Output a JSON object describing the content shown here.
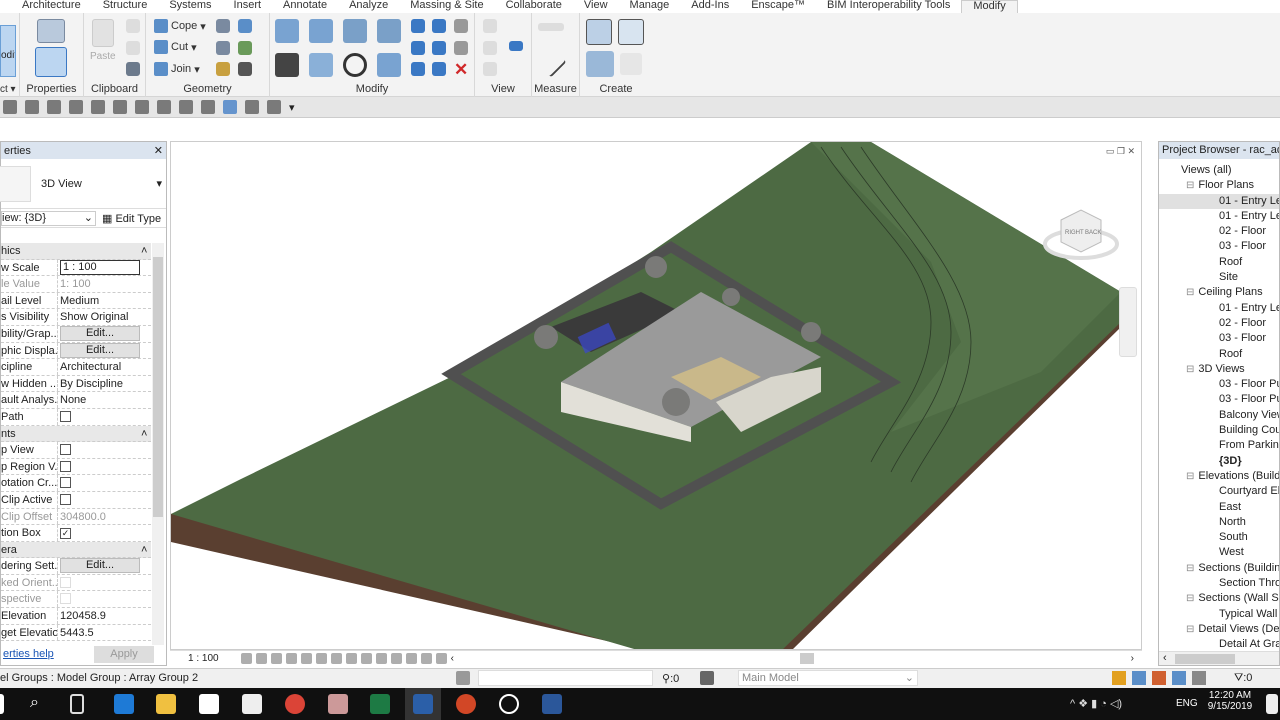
{
  "ribbon": {
    "tabs": [
      "Architecture",
      "Structure",
      "Systems",
      "Insert",
      "Annotate",
      "Analyze",
      "Massing & Site",
      "Collaborate",
      "View",
      "Manage",
      "Add-Ins",
      "Enscape™",
      "BIM Interoperability Tools",
      "Modify"
    ],
    "active_tab": "Modify",
    "modify_label": "odify",
    "select_label": "ct ▾",
    "panels": {
      "properties": "Properties",
      "clipboard": "Clipboard",
      "geometry": "Geometry",
      "modify": "Modify",
      "view": "View",
      "measure": "Measure",
      "create": "Create"
    },
    "clipboard": {
      "paste": "Paste"
    },
    "geometry": {
      "cope": "Cope",
      "cut": "Cut",
      "join": "Join"
    }
  },
  "properties": {
    "title": "erties",
    "close": "✕",
    "type_name": "3D View",
    "instance_selector": "iew: {3D}",
    "edit_type": "Edit Type",
    "rows": [
      {
        "k": "hics",
        "group": true
      },
      {
        "k": "w Scale",
        "v": "1 : 100",
        "kind": "box"
      },
      {
        "k": "le Value",
        "v": "1:  100",
        "kind": "dim"
      },
      {
        "k": "ail Level",
        "v": "Medium"
      },
      {
        "k": "s Visibility",
        "v": "Show Original"
      },
      {
        "k": "bility/Grap...",
        "v": "Edit...",
        "kind": "btn"
      },
      {
        "k": "phic Displa...",
        "v": "Edit...",
        "kind": "btn"
      },
      {
        "k": "cipline",
        "v": "Architectural"
      },
      {
        "k": "w Hidden ...",
        "v": "By Discipline"
      },
      {
        "k": "ault Analys...",
        "v": "None"
      },
      {
        "k": " Path",
        "v": "",
        "kind": "cb"
      },
      {
        "k": "nts",
        "group": true
      },
      {
        "k": "p View",
        "v": "",
        "kind": "cb"
      },
      {
        "k": "p Region V...",
        "v": "",
        "kind": "cb"
      },
      {
        "k": "otation Cr...",
        "v": "",
        "kind": "cb"
      },
      {
        "k": "Clip Active",
        "v": "",
        "kind": "cb"
      },
      {
        "k": "Clip Offset",
        "v": "304800.0",
        "kind": "dim"
      },
      {
        "k": "tion Box",
        "v": "✓",
        "kind": "cb"
      },
      {
        "k": "era",
        "group": true
      },
      {
        "k": "dering Sett...",
        "v": "Edit...",
        "kind": "btn"
      },
      {
        "k": "ked Orient...",
        "v": "",
        "kind": "cbdis"
      },
      {
        "k": "spective",
        "v": "",
        "kind": "cbdis"
      },
      {
        "k": " Elevation",
        "v": "120458.9"
      },
      {
        "k": "get Elevation",
        "v": "5443.5"
      }
    ],
    "help_link": "erties help",
    "apply": "Apply"
  },
  "viewbar": {
    "scale": "1 : 100"
  },
  "browser": {
    "title": "Project Browser - rac_advan",
    "items": [
      {
        "t": "Views (all)",
        "l": 0
      },
      {
        "t": "Floor Plans",
        "l": 1
      },
      {
        "t": "01 - Entry Lev",
        "l": 2,
        "sel": true
      },
      {
        "t": "01 - Entry Lev",
        "l": 2
      },
      {
        "t": "02 - Floor",
        "l": 2
      },
      {
        "t": "03 - Floor",
        "l": 2
      },
      {
        "t": "Roof",
        "l": 2
      },
      {
        "t": "Site",
        "l": 2
      },
      {
        "t": "Ceiling Plans",
        "l": 1
      },
      {
        "t": "01 - Entry Lev",
        "l": 2
      },
      {
        "t": "02 - Floor",
        "l": 2
      },
      {
        "t": "03 - Floor",
        "l": 2
      },
      {
        "t": "Roof",
        "l": 2
      },
      {
        "t": "3D Views",
        "l": 1
      },
      {
        "t": "03 - Floor Pul",
        "l": 2
      },
      {
        "t": "03 - Floor Pul",
        "l": 2
      },
      {
        "t": "Balcony View",
        "l": 2
      },
      {
        "t": "Building Cou",
        "l": 2
      },
      {
        "t": "From Parking",
        "l": 2
      },
      {
        "t": "{3D}",
        "l": 2,
        "bold": true
      },
      {
        "t": "Elevations (Buildi",
        "l": 1
      },
      {
        "t": "Courtyard Ele",
        "l": 2
      },
      {
        "t": "East",
        "l": 2
      },
      {
        "t": "North",
        "l": 2
      },
      {
        "t": "South",
        "l": 2
      },
      {
        "t": "West",
        "l": 2
      },
      {
        "t": "Sections (Buildin",
        "l": 1
      },
      {
        "t": "Section Thro",
        "l": 2
      },
      {
        "t": "Sections (Wall Se",
        "l": 1
      },
      {
        "t": "Typical Wall S",
        "l": 2
      },
      {
        "t": "Detail Views (Det",
        "l": 1
      },
      {
        "t": "Detail At Grad",
        "l": 2
      }
    ]
  },
  "viewcube": {
    "right": "RIGHT",
    "back": "BACK"
  },
  "status": {
    "selection": "el Groups : Model Group : Array Group 2",
    "workset_count": ":0",
    "model": "Main Model",
    "filter_count": ":0"
  },
  "taskbar": {
    "time": "12:20 AM",
    "date": "9/15/2019",
    "lang": "ENG"
  },
  "colors": {
    "terrain": "#4d6a43",
    "terrain_side": "#5a3f30",
    "road": "#555555",
    "accent": "#3a78c4"
  }
}
